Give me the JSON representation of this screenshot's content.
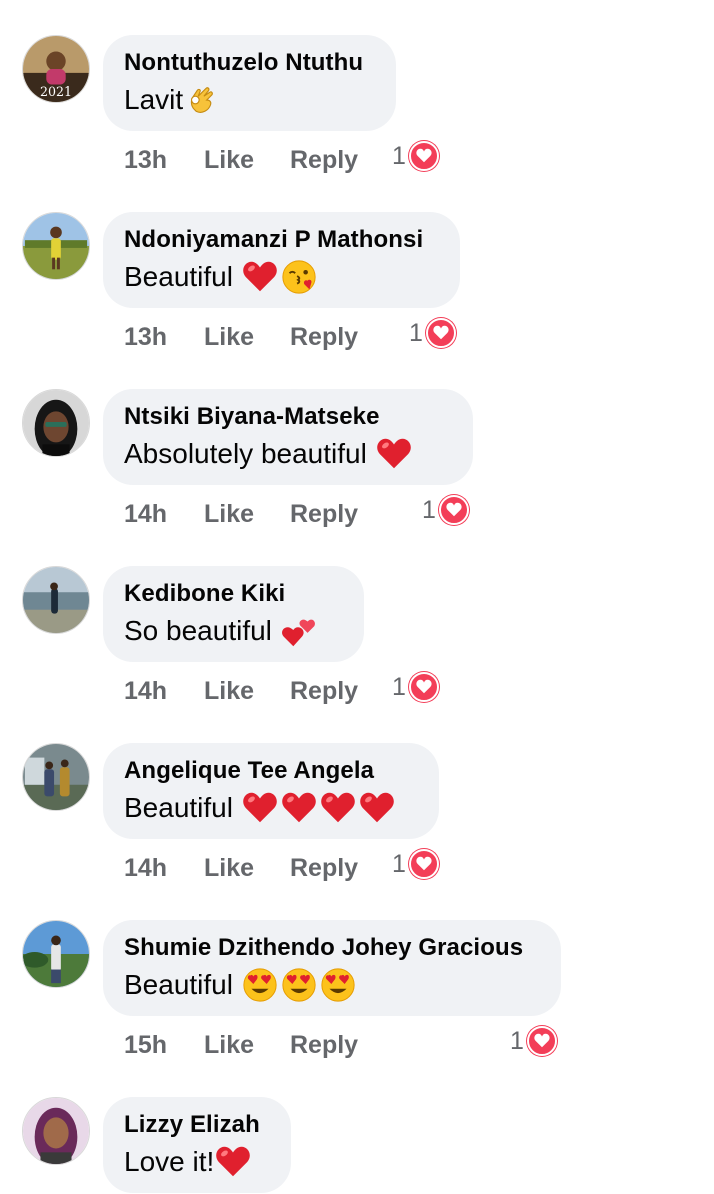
{
  "actions": {
    "like_label": "Like",
    "reply_label": "Reply"
  },
  "colors": {
    "bubble": "#f0f2f5",
    "author": "#050505",
    "meta": "#65676b",
    "love": "#f33e58"
  },
  "comments": [
    {
      "author": "Nontuthuzelo Ntuthu",
      "text": "Lavit",
      "emojis": [
        "ok-hand"
      ],
      "time": "13h",
      "reactions": "1",
      "reaction_type": "love",
      "avatar_text": "2021"
    },
    {
      "author": "Ndoniyamanzi P Mathonsi",
      "text": "Beautiful",
      "emojis": [
        "red-heart",
        "face-blowing-kiss"
      ],
      "time": "13h",
      "reactions": "1",
      "reaction_type": "love"
    },
    {
      "author": "Ntsiki Biyana-Matseke",
      "text": "Absolutely beautiful",
      "emojis": [
        "red-heart"
      ],
      "time": "14h",
      "reactions": "1",
      "reaction_type": "love"
    },
    {
      "author": "Kedibone Kiki",
      "text": "So beautiful",
      "emojis": [
        "two-hearts"
      ],
      "time": "14h",
      "reactions": "1",
      "reaction_type": "love"
    },
    {
      "author": "Angelique Tee Angela",
      "text": "Beautiful",
      "emojis": [
        "red-heart",
        "red-heart",
        "red-heart",
        "red-heart"
      ],
      "time": "14h",
      "reactions": "1",
      "reaction_type": "love"
    },
    {
      "author": "Shumie Dzithendo Johey Gracious",
      "text": "Beautiful",
      "emojis": [
        "heart-eyes",
        "heart-eyes",
        "heart-eyes"
      ],
      "time": "15h",
      "reactions": "1",
      "reaction_type": "love"
    },
    {
      "author": "Lizzy Elizah",
      "text": "Love it!",
      "emojis": [
        "red-heart"
      ],
      "time": "",
      "reactions": "",
      "reaction_type": ""
    }
  ]
}
